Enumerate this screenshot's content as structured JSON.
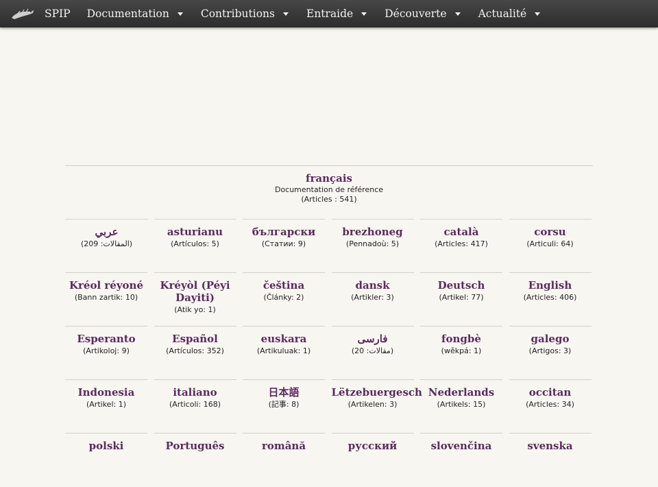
{
  "nav": {
    "brand": "SPIP",
    "items": [
      {
        "label": "Documentation"
      },
      {
        "label": "Contributions"
      },
      {
        "label": "Entraide"
      },
      {
        "label": "Découverte"
      },
      {
        "label": "Actualité"
      }
    ]
  },
  "main_language": {
    "name": "français",
    "subtitle": "Documentation de référence",
    "count": "(Articles : 541)"
  },
  "languages": [
    {
      "name": "عربي",
      "count": "(المقالات: 209)"
    },
    {
      "name": "asturianu",
      "count": "(Artículos: 5)"
    },
    {
      "name": "български",
      "count": "(Статии: 9)"
    },
    {
      "name": "brezhoneg",
      "count": "(Pennadoù: 5)"
    },
    {
      "name": "català",
      "count": "(Articles: 417)"
    },
    {
      "name": "corsu",
      "count": "(Articuli: 64)"
    },
    {
      "name": "Kréol réyoné",
      "count": "(Bann zartik: 10)"
    },
    {
      "name": "Kréyòl (Péyi Dayiti)",
      "count": "(Atik yo: 1)"
    },
    {
      "name": "čeština",
      "count": "(Články: 2)"
    },
    {
      "name": "dansk",
      "count": "(Artikler: 3)"
    },
    {
      "name": "Deutsch",
      "count": "(Artikel: 77)"
    },
    {
      "name": "English",
      "count": "(Articles: 406)"
    },
    {
      "name": "Esperanto",
      "count": "(Artikoloj: 9)"
    },
    {
      "name": "Español",
      "count": "(Artículos: 352)"
    },
    {
      "name": "euskara",
      "count": "(Artikuluak: 1)"
    },
    {
      "name": "فارسى",
      "count": "(مقالات: 20)"
    },
    {
      "name": "fongbè",
      "count": "(wěkpá: 1)"
    },
    {
      "name": "galego",
      "count": "(Artigos: 3)"
    },
    {
      "name": "Indonesia",
      "count": "(Artikel: 1)"
    },
    {
      "name": "italiano",
      "count": "(Articoli: 168)"
    },
    {
      "name": "日本語",
      "count": "(記事: 8)"
    },
    {
      "name": "Lëtzebuergesch",
      "count": "(Artikelen: 3)"
    },
    {
      "name": "Nederlands",
      "count": "(Artikels: 15)"
    },
    {
      "name": "occitan",
      "count": "(Articles: 34)"
    },
    {
      "name": "polski",
      "count": ""
    },
    {
      "name": "Português",
      "count": ""
    },
    {
      "name": "română",
      "count": ""
    },
    {
      "name": "русский",
      "count": ""
    },
    {
      "name": "slovenčina",
      "count": ""
    },
    {
      "name": "svenska",
      "count": ""
    }
  ]
}
